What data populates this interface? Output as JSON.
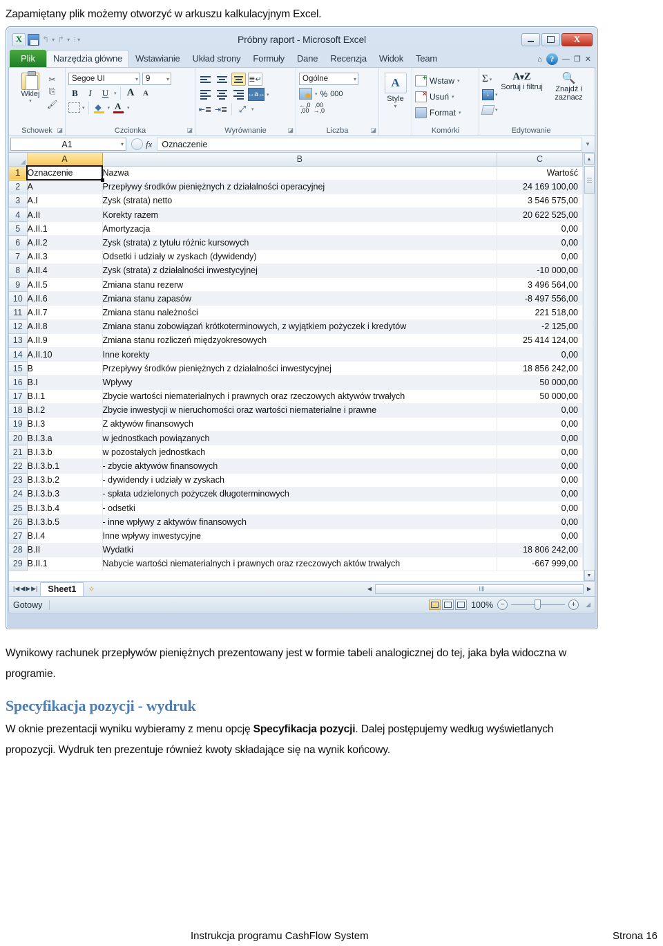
{
  "document": {
    "intro_line": "Zapamiętany plik możemy otworzyć w arkuszu kalkulacyjnym Excel.",
    "para_1": "Wynikowy rachunek przepływów pieniężnych prezentowany jest w formie tabeli analogicznej do tej, jaka była widoczna w programie.",
    "heading_spec": "Specyfikacja pozycji - wydruk",
    "para_2_part1": "W oknie prezentacji wyniku wybieramy z menu opcję ",
    "para_2_bold": "Specyfikacja pozycji",
    "para_2_part2": ". Dalej postępujemy według wyświetlanych propozycji. Wydruk ten prezentuje również kwoty składające się na wynik końcowy.",
    "footer_left": "Instrukcja programu CashFlow System",
    "footer_right": "Strona 16"
  },
  "excel": {
    "title": "Próbny raport  -  Microsoft Excel",
    "window_buttons": {
      "minimize": "",
      "maximize": "",
      "close": "X"
    },
    "quick_access": {
      "logo": "X",
      "save": "save-icon",
      "undo": "↰",
      "redo": "↱",
      "more": "▾"
    },
    "tabs": [
      {
        "label": "Plik",
        "type": "file"
      },
      {
        "label": "Narzędzia główne",
        "active": true
      },
      {
        "label": "Wstawianie"
      },
      {
        "label": "Układ strony"
      },
      {
        "label": "Formuły"
      },
      {
        "label": "Dane"
      },
      {
        "label": "Recenzja"
      },
      {
        "label": "Widok"
      },
      {
        "label": "Team"
      }
    ],
    "tab_right": {
      "ribbon_collapse": "⌂",
      "help": "?",
      "min": "—",
      "restore": "❐",
      "close": "✕"
    },
    "ribbon": {
      "groups": [
        {
          "name": "Schowek",
          "label": "Schowek"
        },
        {
          "name": "Czcionka",
          "label": "Czcionka"
        },
        {
          "name": "Wyrównanie",
          "label": "Wyrównanie"
        },
        {
          "name": "Liczba",
          "label": "Liczba"
        },
        {
          "name": "Style",
          "label": ""
        },
        {
          "name": "Komórki",
          "label": "Komórki"
        },
        {
          "name": "Edytowanie",
          "label": "Edytowanie"
        }
      ],
      "clipboard": {
        "paste_label": "Wklej",
        "cut": "✂",
        "copy": "⎘",
        "format_painter": "🖌"
      },
      "font": {
        "font_name": "Segoe UI",
        "font_size": "9",
        "bold": "B",
        "italic": "I",
        "underline": "U",
        "grow": "A",
        "shrink": "A",
        "fill_color": "A",
        "font_color": "A"
      },
      "number": {
        "format": "Ogólne",
        "percent": "%",
        "comma": "000"
      },
      "style": {
        "label": "Style"
      },
      "cells": {
        "insert": "Wstaw",
        "delete": "Usuń",
        "format": "Format"
      },
      "editing": {
        "sum": "Σ",
        "sort_filter": "Sortuj i filtruj",
        "find_select": "Znajdź i zaznacz"
      }
    },
    "formula_bar": {
      "name_box": "A1",
      "fx": "fx",
      "value": "Oznaczenie"
    },
    "grid": {
      "columns": [
        "A",
        "B",
        "C"
      ],
      "header_row_index": 1,
      "rows": [
        {
          "n": 1,
          "a": "Oznaczenie",
          "b": "Nazwa",
          "c": "Wartość"
        },
        {
          "n": 2,
          "a": "A",
          "b": "Przepływy środków pieniężnych z działalności operacyjnej",
          "c": "24 169 100,00"
        },
        {
          "n": 3,
          "a": "A.I",
          "b": "Zysk (strata) netto",
          "c": "3 546 575,00"
        },
        {
          "n": 4,
          "a": "A.II",
          "b": "Korekty razem",
          "c": "20 622 525,00"
        },
        {
          "n": 5,
          "a": "A.II.1",
          "b": "Amortyzacja",
          "c": "0,00"
        },
        {
          "n": 6,
          "a": "A.II.2",
          "b": "Zysk (strata) z tytułu różnic kursowych",
          "c": "0,00"
        },
        {
          "n": 7,
          "a": "A.II.3",
          "b": "Odsetki i udziały w zyskach (dywidendy)",
          "c": "0,00"
        },
        {
          "n": 8,
          "a": "A.II.4",
          "b": "Zysk (strata) z działalności inwestycyjnej",
          "c": "-10 000,00"
        },
        {
          "n": 9,
          "a": "A.II.5",
          "b": "Zmiana stanu rezerw",
          "c": "3 496 564,00"
        },
        {
          "n": 10,
          "a": "A.II.6",
          "b": "Zmiana stanu zapasów",
          "c": "-8 497 556,00"
        },
        {
          "n": 11,
          "a": "A.II.7",
          "b": "Zmiana stanu należności",
          "c": "221 518,00"
        },
        {
          "n": 12,
          "a": "A.II.8",
          "b": "Zmiana stanu zobowiązań krótkoterminowych, z wyjątkiem pożyczek i kredytów",
          "c": "-2 125,00"
        },
        {
          "n": 13,
          "a": "A.II.9",
          "b": "Zmiana stanu rozliczeń międzyokresowych",
          "c": "25 414 124,00"
        },
        {
          "n": 14,
          "a": "A.II.10",
          "b": "Inne korekty",
          "c": "0,00"
        },
        {
          "n": 15,
          "a": "B",
          "b": "Przepływy środków pieniężnych z działalności inwestycyjnej",
          "c": "18 856 242,00"
        },
        {
          "n": 16,
          "a": "B.I",
          "b": "Wpływy",
          "c": "50 000,00"
        },
        {
          "n": 17,
          "a": "B.I.1",
          "b": "Zbycie wartości niematerialnych i prawnych oraz rzeczowych aktywów trwałych",
          "c": "50 000,00"
        },
        {
          "n": 18,
          "a": "B.I.2",
          "b": "Zbycie inwestycji w nieruchomości oraz wartości niematerialne i prawne",
          "c": "0,00"
        },
        {
          "n": 19,
          "a": "B.I.3",
          "b": "Z aktywów finansowych",
          "c": "0,00"
        },
        {
          "n": 20,
          "a": "B.I.3.a",
          "b": "w jednostkach powiązanych",
          "c": "0,00"
        },
        {
          "n": 21,
          "a": "B.I.3.b",
          "b": "w pozostałych jednostkach",
          "c": "0,00"
        },
        {
          "n": 22,
          "a": "B.I.3.b.1",
          "b": "- zbycie aktywów finansowych",
          "c": "0,00"
        },
        {
          "n": 23,
          "a": "B.I.3.b.2",
          "b": "- dywidendy i udziały w zyskach",
          "c": "0,00"
        },
        {
          "n": 24,
          "a": "B.I.3.b.3",
          "b": "- spłata udzielonych pożyczek długoterminowych",
          "c": "0,00"
        },
        {
          "n": 25,
          "a": "B.I.3.b.4",
          "b": "- odsetki",
          "c": "0,00"
        },
        {
          "n": 26,
          "a": "B.I.3.b.5",
          "b": "- inne wpływy z aktywów finansowych",
          "c": "0,00"
        },
        {
          "n": 27,
          "a": "B.I.4",
          "b": "Inne wpływy inwestycyjne",
          "c": "0,00"
        },
        {
          "n": 28,
          "a": "B.II",
          "b": "Wydatki",
          "c": "18 806 242,00"
        },
        {
          "n": 29,
          "a": "B.II.1",
          "b": "Nabycie wartości niematerialnych i prawnych oraz rzeczowych aktów trwałych",
          "c": "-667 999,00"
        }
      ]
    },
    "sheet_tabs": {
      "sheet1": "Sheet1"
    },
    "status_bar": {
      "state": "Gotowy",
      "zoom": "100%"
    }
  }
}
